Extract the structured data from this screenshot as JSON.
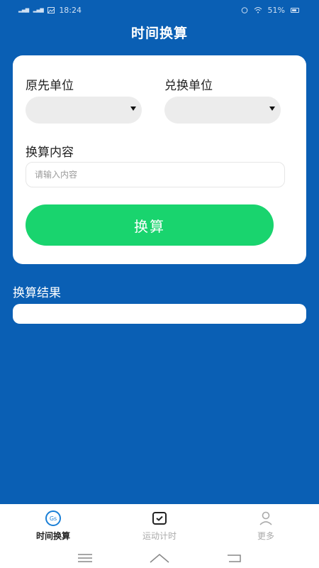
{
  "status_bar": {
    "time": "18:24",
    "battery": "51%"
  },
  "header": {
    "title": "时间换算"
  },
  "form": {
    "original_unit_label": "原先单位",
    "target_unit_label": "兑换单位",
    "content_label": "换算内容",
    "content_placeholder": "请输入内容",
    "convert_button": "换算"
  },
  "result": {
    "label": "换算结果"
  },
  "bottom_nav": {
    "tabs": [
      {
        "label": "时间换算",
        "icon": "clock-icon",
        "active": true
      },
      {
        "label": "运动计时",
        "icon": "timer-icon",
        "active": false
      },
      {
        "label": "更多",
        "icon": "user-icon",
        "active": false
      }
    ]
  },
  "colors": {
    "background": "#0a5fb4",
    "button": "#19d46e",
    "active_icon": "#1a7fd6"
  }
}
